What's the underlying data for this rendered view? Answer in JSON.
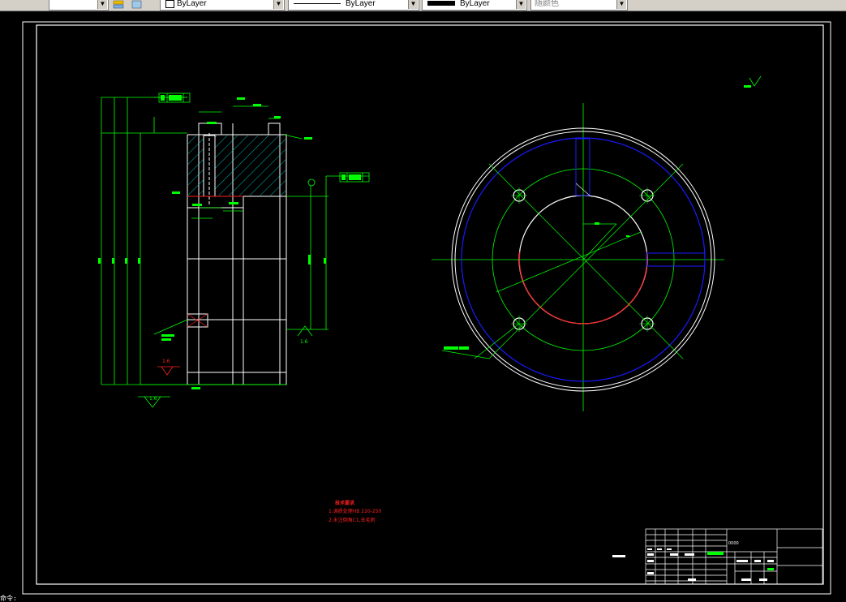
{
  "toolbar": {
    "layer_combo": "ByLayer",
    "linetype_combo": "ByLayer",
    "lineweight_combo": "ByLayer",
    "color_combo": "随颜色"
  },
  "drawing": {
    "tolerance_left": "0.0",
    "tolerance_right": "0.0",
    "roughness_left": "1.6",
    "roughness_bottom": "1.6",
    "roughness_right": "1.6",
    "notes_title": "技术要求",
    "notes_line1": "1.调质处理HB 220-250",
    "notes_line2": "2.未注倒角C1,去毛刺",
    "title_block_code": "0000"
  },
  "command": {
    "prompt": "命令:"
  },
  "colors": {
    "frame": "#ffffff",
    "dimension": "#00ff00",
    "hatch": "#00e0e0",
    "center": "#00ff00",
    "blue": "#1a1aff",
    "red": "#ff2020"
  }
}
